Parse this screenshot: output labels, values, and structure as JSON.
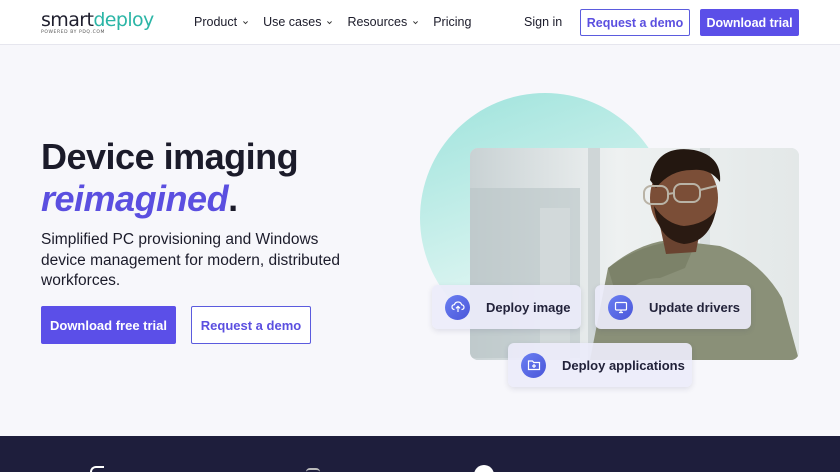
{
  "nav": {
    "logo": {
      "prefix": "smart",
      "accent": "deploy",
      "tagline": "POWERED BY PDQ.COM"
    },
    "menu": [
      {
        "label": "Product",
        "has_dropdown": true
      },
      {
        "label": "Use cases",
        "has_dropdown": true
      },
      {
        "label": "Resources",
        "has_dropdown": true
      },
      {
        "label": "Pricing",
        "has_dropdown": false
      }
    ],
    "sign_in": "Sign in",
    "request_demo": "Request a demo",
    "download_trial": "Download trial"
  },
  "hero": {
    "headline_line1": "Device imaging",
    "headline_italic": "reimagined",
    "headline_period": ".",
    "subtitle": "Simplified PC provisioning and Windows device management for modern, distributed workforces.",
    "primary_cta": "Download free trial",
    "secondary_cta": "Request a demo"
  },
  "features": [
    {
      "label": "Deploy image",
      "icon": "cloud-upload-icon"
    },
    {
      "label": "Update drivers",
      "icon": "monitor-icon"
    },
    {
      "label": "Deploy applications",
      "icon": "folder-plus-icon"
    }
  ],
  "colors": {
    "brand": "#5b4fe8",
    "logo_accent": "#2bb5a6",
    "footer_band": "#1e1e3c"
  }
}
